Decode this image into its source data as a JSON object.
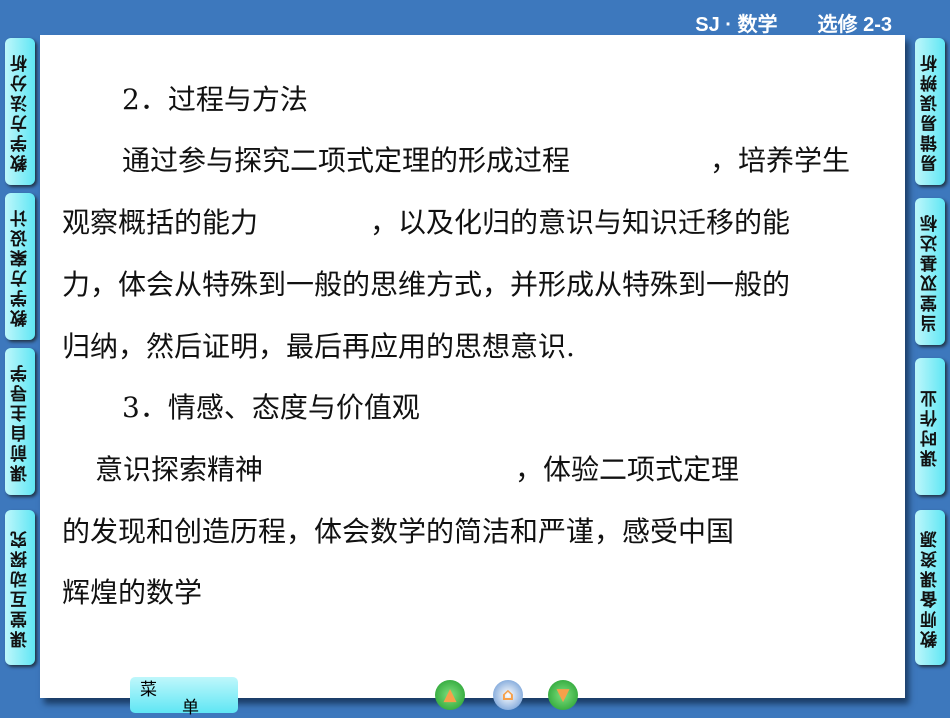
{
  "header": {
    "series": "SJ · 数学",
    "volume": "选修 2-3"
  },
  "left_tabs": [
    "教学方法分析",
    "教学方案设计",
    "课前自主导学",
    "课堂互动探究"
  ],
  "right_tabs": [
    "易错易误辨析",
    "当堂双基达标",
    "课时作业",
    "教师备课资源"
  ],
  "content": {
    "lines": [
      "2．过程与方法",
      "通过参与探究二项式定理的形成过程　　　　　，培养学生",
      "观察概括的能力　　　　，以及化归的意识与知识迁移的能",
      "力，体会从特殊到一般的思维方式，并形成从特殊到一般的",
      "归纳，然后证明，最后再应用的思想意识.",
      "3．情感、态度与价值观",
      "意识探索精神　　　　　　　　　，体验二项式定理",
      "的发现和创造历程，体会数学的简洁和严谨，感受中国",
      "辉煌的数学"
    ]
  },
  "footer": {
    "menu_1": "菜",
    "menu_2": "单",
    "prev": "▲",
    "home": "⌂",
    "next": "▼"
  }
}
